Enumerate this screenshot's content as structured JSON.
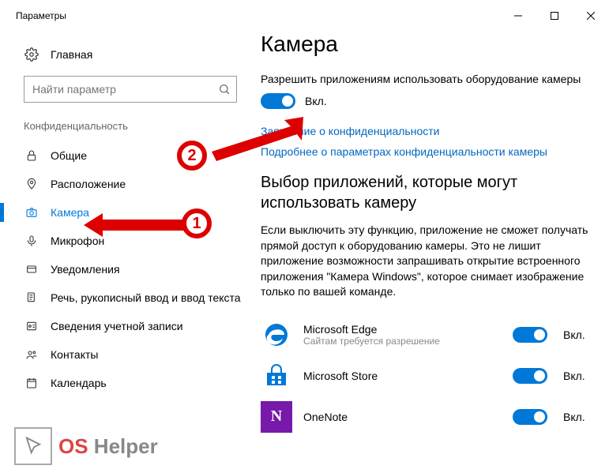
{
  "titlebar": {
    "title": "Параметры"
  },
  "sidebar": {
    "home_label": "Главная",
    "search_placeholder": "Найти параметр",
    "group_title": "Конфиденциальность",
    "items": [
      {
        "label": "Общие"
      },
      {
        "label": "Расположение"
      },
      {
        "label": "Камера"
      },
      {
        "label": "Микрофон"
      },
      {
        "label": "Уведомления"
      },
      {
        "label": "Речь, рукописный ввод и ввод текста"
      },
      {
        "label": "Сведения учетной записи"
      },
      {
        "label": "Контакты"
      },
      {
        "label": "Календарь"
      }
    ]
  },
  "content": {
    "title": "Камера",
    "allow_apps_heading": "Разрешить приложениям использовать оборудование камеры",
    "main_toggle_state": "Вкл.",
    "link_privacy": "Заявление о конфиденциальности",
    "link_more": "Подробнее о параметрах конфиденциальности камеры",
    "choose_heading": "Выбор приложений, которые могут использовать камеру",
    "choose_body": "Если выключить эту функцию, приложение не сможет получать прямой доступ к оборудованию камеры. Это не лишит приложение возможности запрашивать открытие встроенного приложения \"Камера Windows\", которое снимает изображение только по вашей команде.",
    "apps": [
      {
        "name": "Microsoft Edge",
        "sub": "Сайтам требуется разрешение",
        "state": "Вкл.",
        "bg": "#0078d7",
        "glyph": "e"
      },
      {
        "name": "Microsoft Store",
        "sub": "",
        "state": "Вкл.",
        "bg": "#0078d7",
        "glyph": "bag"
      },
      {
        "name": "OneNote",
        "sub": "",
        "state": "Вкл.",
        "bg": "#7719aa",
        "glyph": "N"
      }
    ]
  },
  "annotations": {
    "marker1": "1",
    "marker2": "2"
  },
  "watermark": {
    "os": "OS",
    "helper": " Helper"
  }
}
